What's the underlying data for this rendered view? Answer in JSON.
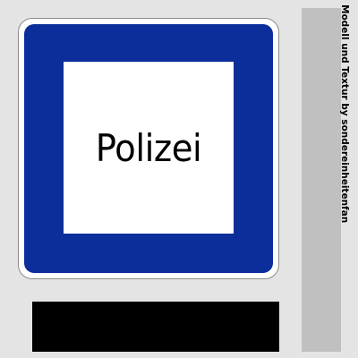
{
  "sign": {
    "text": "Polizei"
  },
  "credit": {
    "text": "Modell und Textur by sondereinheitenfan"
  },
  "colors": {
    "background": "#e4e4e4",
    "sign_blue": "#0c2e9a",
    "sign_white": "#ffffff",
    "plate": "#000000",
    "side_strip": "#c0c0c0"
  }
}
